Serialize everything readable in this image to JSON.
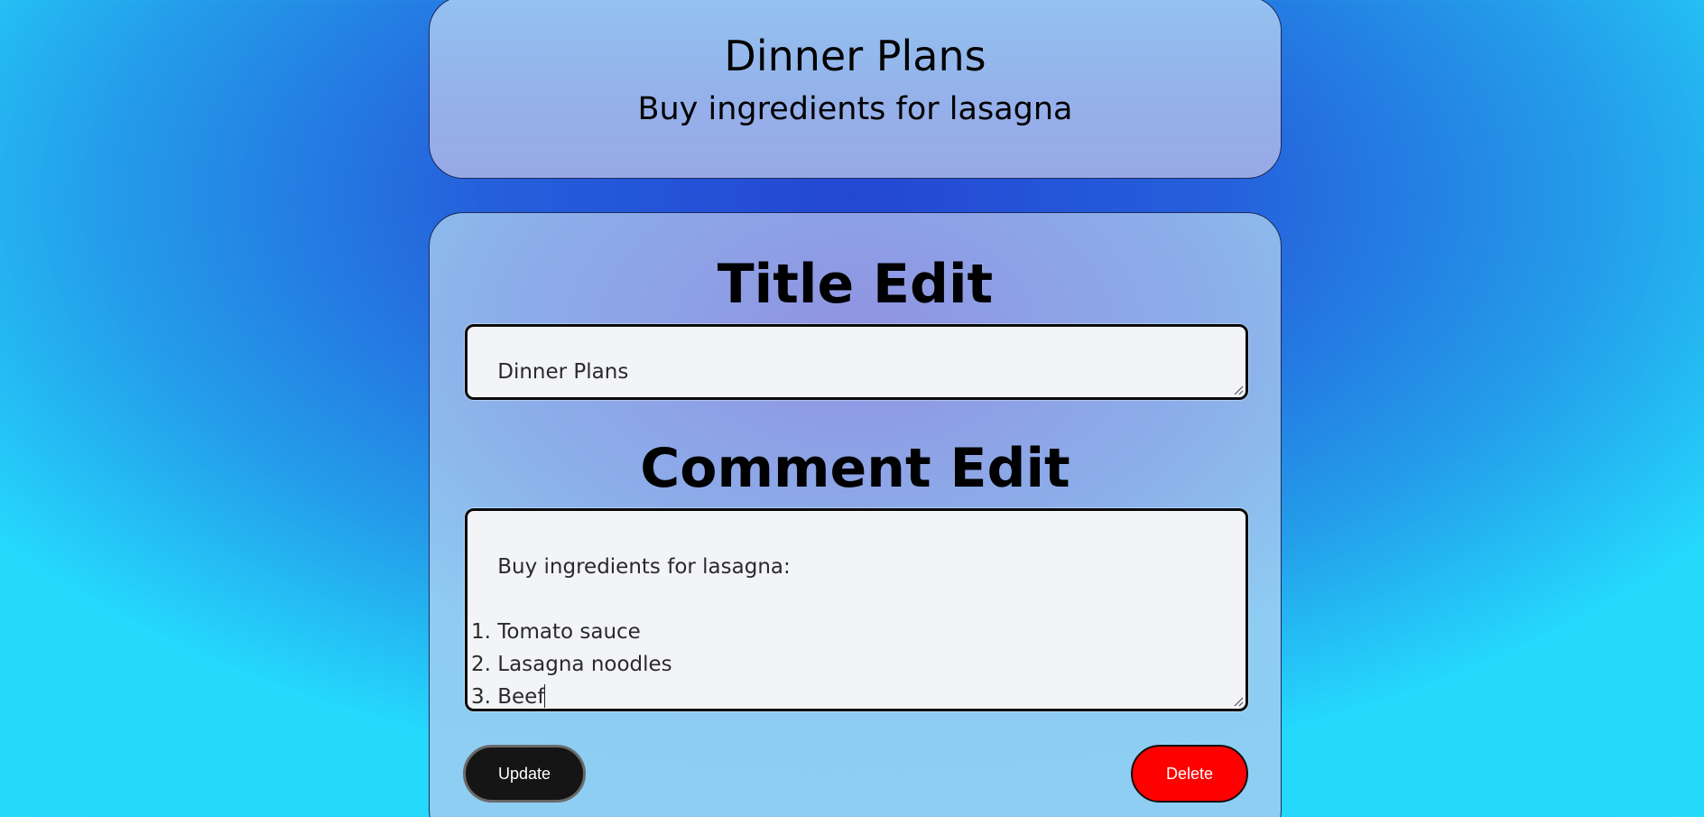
{
  "preview": {
    "title": "Dinner Plans",
    "comment": "Buy ingredients for lasagna"
  },
  "editor": {
    "title_heading": "Title Edit",
    "title_value": "Dinner Plans",
    "comment_heading": "Comment Edit",
    "comment_value": "Buy ingredients for lasagna:\n\n1. Tomato sauce\n2. Lasagna noodles\n3. Beef"
  },
  "actions": {
    "update_label": "Update",
    "delete_label": "Delete"
  },
  "colors": {
    "update_button": "#151515",
    "delete_button": "#fe0000"
  },
  "icons": {
    "resize_grip": "resize-grip-icon"
  }
}
